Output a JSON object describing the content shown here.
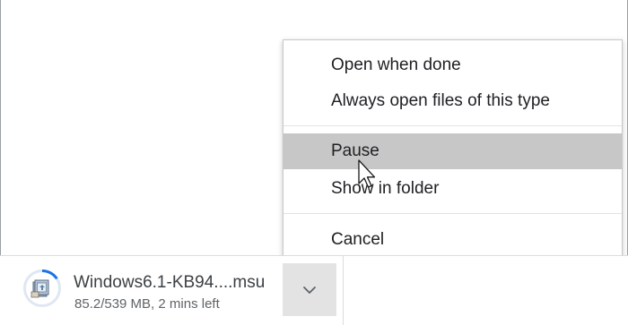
{
  "context_menu": {
    "open_when_done": "Open when done",
    "always_open": "Always open files of this type",
    "pause": "Pause",
    "show_in_folder": "Show in folder",
    "cancel": "Cancel",
    "hovered_item": "Pause"
  },
  "download": {
    "file_name": "Windows6.1-KB94....msu",
    "status": "85.2/539 MB, 2 mins left",
    "progress_fraction": 0.158,
    "icon": "installer-package-icon",
    "menu_icon": "chevron-down-icon"
  },
  "colors": {
    "hover_bg": "#c7c7c7",
    "progress_ring": "#1a73e8",
    "toggle_bg": "#e3e3e3"
  }
}
